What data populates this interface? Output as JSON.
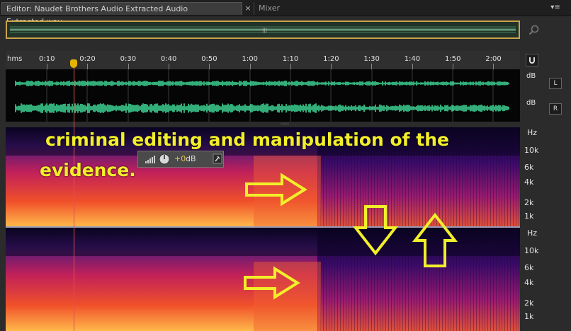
{
  "tabs": {
    "editor_label": "Editor: Naudet Brothers Audio Extracted Audio Extracted.wav",
    "close_glyph": "×",
    "mixer_label": "Mixer",
    "menu_glyph": "▾≡"
  },
  "ruler": {
    "unit_label": "hms",
    "ticks": [
      "0:10",
      "0:20",
      "0:30",
      "0:40",
      "0:50",
      "1:00",
      "1:10",
      "1:20",
      "1:30",
      "1:40",
      "1:50",
      "2:00"
    ]
  },
  "waveform": {
    "left_db": "dB",
    "right_db": "dB",
    "left_button": "L",
    "right_button": "R"
  },
  "spectral": {
    "top_scale": {
      "unit": "Hz",
      "labels": [
        "10k",
        "6k",
        "4k",
        "2k",
        "1k"
      ]
    },
    "bottom_scale": {
      "unit": "Hz",
      "labels": [
        "10k",
        "6k",
        "4k",
        "2k",
        "1k"
      ]
    }
  },
  "hud": {
    "value": "+0",
    "unit": "dB"
  },
  "annotation": {
    "line1": "criminal editing and manipulation of the",
    "line2": "evidence."
  },
  "colors": {
    "waveform": "#3fd898",
    "playhead": "#e05050",
    "annotation": "#f2ef2a",
    "overview_border": "#c9a44a"
  },
  "icons": {
    "zoom": "magnify-icon",
    "snap": "magnet-icon",
    "hud_meter": "volume-meter-icon",
    "hud_knob": "knob-icon",
    "hud_pin": "pin-icon"
  }
}
